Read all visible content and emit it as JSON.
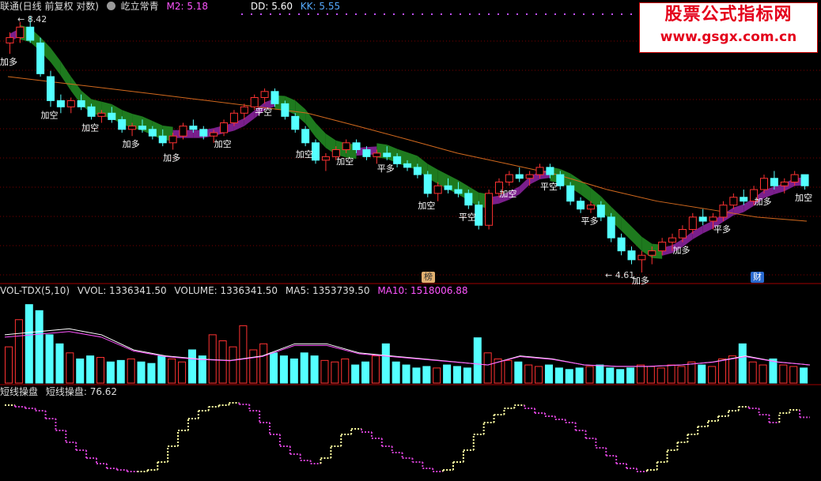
{
  "main_header": {
    "title": "联通(日线 前复权 对数)",
    "indicator_name": "屹立常青",
    "m2_label": "M2: 5.18",
    "dd_label": "DD: 5.60",
    "kk_label": "KK: 5.55",
    "colors": {
      "title": "#dddddd",
      "indicator": "#dddddd",
      "m2": "#ff55ff",
      "dd": "#ffffff",
      "kk": "#55aaff"
    }
  },
  "watermark": {
    "line1": "股票公式指标网",
    "line2": "www.gsgx.com.cn"
  },
  "price_annotations": {
    "high_label": "8.42",
    "low_label": "4.61",
    "bang_tag": "榜",
    "cai_tag": "财",
    "labels": [
      "加多",
      "加空",
      "加空",
      "加多",
      "加多",
      "加空",
      "平空",
      "加空",
      "加空",
      "平多",
      "加空",
      "平空",
      "加空",
      "平空",
      "平多",
      "加多",
      "加多",
      "平多",
      "加多",
      "加空"
    ]
  },
  "volume_header": {
    "name": "VOL-TDX(5,10)",
    "vvol": "VVOL: 1336341.50",
    "volume": "VOLUME: 1336341.50",
    "ma5": "MA5: 1353739.50",
    "ma10": "MA10: 1518006.88"
  },
  "osc_header": {
    "name": "短线操盘",
    "value": "短线操盘: 76.62"
  },
  "colors": {
    "up": "#ff3232",
    "down": "#54ffff",
    "flat": "#ffffff",
    "ribbon_up": "#7a1f8c",
    "ribbon_down": "#1e7a1e",
    "ma_long": "#d2691e",
    "grid": "#7a0000",
    "osc_rise": "#ffffa0",
    "osc_fall": "#d040d0"
  },
  "chart_data": {
    "type": "candlestick",
    "price_range": [
      4.61,
      8.42
    ],
    "candles": [
      [
        7.9,
        8.1,
        7.7,
        8.0
      ],
      [
        8.0,
        8.3,
        7.9,
        8.2
      ],
      [
        8.2,
        8.42,
        7.9,
        7.95
      ],
      [
        7.9,
        8.0,
        7.3,
        7.35
      ],
      [
        7.3,
        7.4,
        6.8,
        6.9
      ],
      [
        6.9,
        7.0,
        6.7,
        6.8
      ],
      [
        6.8,
        6.95,
        6.7,
        6.9
      ],
      [
        6.9,
        7.0,
        6.75,
        6.8
      ],
      [
        6.8,
        6.85,
        6.6,
        6.65
      ],
      [
        6.65,
        6.75,
        6.55,
        6.7
      ],
      [
        6.7,
        6.8,
        6.55,
        6.6
      ],
      [
        6.6,
        6.65,
        6.4,
        6.45
      ],
      [
        6.45,
        6.55,
        6.35,
        6.5
      ],
      [
        6.5,
        6.6,
        6.4,
        6.45
      ],
      [
        6.45,
        6.5,
        6.3,
        6.35
      ],
      [
        6.35,
        6.45,
        6.2,
        6.25
      ],
      [
        6.25,
        6.4,
        6.15,
        6.35
      ],
      [
        6.35,
        6.55,
        6.3,
        6.5
      ],
      [
        6.5,
        6.6,
        6.4,
        6.45
      ],
      [
        6.45,
        6.5,
        6.3,
        6.35
      ],
      [
        6.35,
        6.45,
        6.25,
        6.4
      ],
      [
        6.4,
        6.6,
        6.35,
        6.55
      ],
      [
        6.55,
        6.75,
        6.5,
        6.7
      ],
      [
        6.7,
        6.85,
        6.6,
        6.8
      ],
      [
        6.8,
        7.0,
        6.75,
        6.95
      ],
      [
        6.95,
        7.1,
        6.85,
        7.05
      ],
      [
        7.05,
        7.1,
        6.8,
        6.85
      ],
      [
        6.85,
        6.9,
        6.6,
        6.65
      ],
      [
        6.65,
        6.7,
        6.4,
        6.45
      ],
      [
        6.45,
        6.5,
        6.2,
        6.25
      ],
      [
        6.25,
        6.3,
        5.95,
        6.0
      ],
      [
        6.0,
        6.1,
        5.85,
        6.05
      ],
      [
        6.05,
        6.2,
        6.0,
        6.15
      ],
      [
        6.15,
        6.3,
        6.1,
        6.25
      ],
      [
        6.25,
        6.3,
        6.1,
        6.15
      ],
      [
        6.15,
        6.2,
        6.0,
        6.05
      ],
      [
        6.05,
        6.15,
        5.95,
        6.1
      ],
      [
        6.1,
        6.2,
        6.0,
        6.05
      ],
      [
        6.05,
        6.1,
        5.9,
        5.95
      ],
      [
        5.95,
        6.0,
        5.85,
        5.9
      ],
      [
        5.9,
        5.95,
        5.75,
        5.8
      ],
      [
        5.8,
        5.85,
        5.5,
        5.55
      ],
      [
        5.55,
        5.7,
        5.45,
        5.65
      ],
      [
        5.65,
        5.75,
        5.55,
        5.6
      ],
      [
        5.6,
        5.7,
        5.5,
        5.55
      ],
      [
        5.55,
        5.6,
        5.35,
        5.4
      ],
      [
        5.4,
        5.45,
        5.1,
        5.15
      ],
      [
        5.15,
        5.6,
        5.1,
        5.55
      ],
      [
        5.55,
        5.75,
        5.5,
        5.7
      ],
      [
        5.7,
        5.85,
        5.65,
        5.8
      ],
      [
        5.8,
        5.9,
        5.7,
        5.75
      ],
      [
        5.75,
        5.85,
        5.65,
        5.8
      ],
      [
        5.8,
        5.95,
        5.75,
        5.9
      ],
      [
        5.9,
        5.95,
        5.75,
        5.8
      ],
      [
        5.8,
        5.85,
        5.6,
        5.65
      ],
      [
        5.65,
        5.7,
        5.4,
        5.45
      ],
      [
        5.45,
        5.5,
        5.3,
        5.35
      ],
      [
        5.35,
        5.45,
        5.3,
        5.4
      ],
      [
        5.4,
        5.45,
        5.2,
        5.25
      ],
      [
        5.25,
        5.3,
        4.95,
        5.0
      ],
      [
        5.0,
        5.05,
        4.8,
        4.85
      ],
      [
        4.85,
        4.9,
        4.7,
        4.75
      ],
      [
        4.75,
        4.85,
        4.61,
        4.8
      ],
      [
        4.8,
        4.9,
        4.7,
        4.85
      ],
      [
        4.85,
        5.0,
        4.8,
        4.95
      ],
      [
        4.95,
        5.05,
        4.85,
        5.0
      ],
      [
        5.0,
        5.15,
        4.95,
        5.1
      ],
      [
        5.1,
        5.3,
        5.05,
        5.25
      ],
      [
        5.25,
        5.35,
        5.15,
        5.2
      ],
      [
        5.2,
        5.3,
        5.1,
        5.25
      ],
      [
        5.25,
        5.45,
        5.2,
        5.4
      ],
      [
        5.4,
        5.55,
        5.35,
        5.5
      ],
      [
        5.5,
        5.6,
        5.4,
        5.45
      ],
      [
        5.45,
        5.65,
        5.4,
        5.6
      ],
      [
        5.6,
        5.8,
        5.55,
        5.75
      ],
      [
        5.75,
        5.85,
        5.6,
        5.65
      ],
      [
        5.65,
        5.75,
        5.55,
        5.7
      ],
      [
        5.7,
        5.85,
        5.65,
        5.8
      ],
      [
        5.8,
        5.75,
        5.6,
        5.65
      ]
    ],
    "ma_long": [
      7.3,
      7.2,
      7.1,
      7.0,
      6.9,
      6.8,
      6.7,
      6.5,
      6.3,
      6.1,
      5.95,
      5.8,
      5.6,
      5.45,
      5.35,
      5.25,
      5.2
    ],
    "volume": [
      1.2,
      2.1,
      2.6,
      2.4,
      1.6,
      1.3,
      1.0,
      0.8,
      0.9,
      0.85,
      0.7,
      0.75,
      0.8,
      0.7,
      0.65,
      0.9,
      0.8,
      0.7,
      1.1,
      0.9,
      1.6,
      1.4,
      1.2,
      1.9,
      1.1,
      1.3,
      1.0,
      0.9,
      0.8,
      1.0,
      0.9,
      0.75,
      0.7,
      0.8,
      0.6,
      0.7,
      0.9,
      1.3,
      0.7,
      0.6,
      0.5,
      0.55,
      0.5,
      0.6,
      0.55,
      0.5,
      1.5,
      1.0,
      0.8,
      0.75,
      0.7,
      0.6,
      0.55,
      0.6,
      0.5,
      0.45,
      0.5,
      0.55,
      0.6,
      0.5,
      0.45,
      0.5,
      0.6,
      0.55,
      0.5,
      0.6,
      0.55,
      0.7,
      0.6,
      0.55,
      0.8,
      0.9,
      1.3,
      0.7,
      0.6,
      0.8,
      0.6,
      0.55,
      0.5
    ],
    "volume_ma5": [
      1.6,
      1.7,
      1.8,
      1.6,
      1.1,
      0.9,
      0.8,
      0.75,
      0.9,
      1.3,
      1.3,
      1.0,
      0.9,
      0.8,
      0.7,
      0.6,
      0.9,
      0.8,
      0.6,
      0.55,
      0.55,
      0.6,
      0.7,
      0.9,
      0.7,
      0.6
    ],
    "oscillator": [
      92,
      90,
      88,
      85,
      75,
      60,
      45,
      35,
      25,
      18,
      12,
      10,
      8,
      8,
      10,
      20,
      40,
      60,
      75,
      85,
      90,
      92,
      95,
      93,
      85,
      70,
      55,
      40,
      30,
      22,
      18,
      25,
      40,
      55,
      62,
      58,
      50,
      40,
      32,
      25,
      20,
      12,
      8,
      10,
      20,
      35,
      55,
      70,
      80,
      88,
      92,
      88,
      82,
      78,
      74,
      70,
      60,
      50,
      38,
      28,
      18,
      12,
      8,
      10,
      20,
      35,
      45,
      55,
      65,
      72,
      78,
      85,
      90,
      88,
      80,
      70,
      82,
      86,
      76.62
    ],
    "oscillator_value": 76.62
  }
}
